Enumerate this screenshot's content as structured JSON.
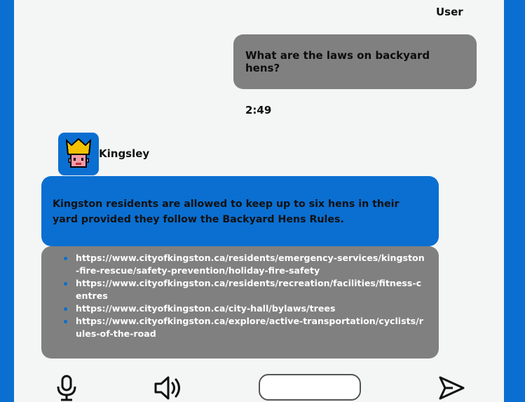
{
  "chat": {
    "user_label": "User",
    "user_message": "What are the laws on backyard hens?",
    "timestamp": "2:49",
    "bot_name": "Kingsley",
    "bot_message": "Kingston residents are allowed to keep up to six hens in their yard provided they follow the Backyard Hens Rules.",
    "sources": [
      "https://www.cityofkingston.ca/residents/emergency-services/kingston-fire-rescue/safety-prevention/holiday-fire-safety",
      "https://www.cityofkingston.ca/residents/recreation/facilities/fitness-centres",
      "https://www.cityofkingston.ca/city-hall/bylaws/trees",
      "https://www.cityofkingston.ca/explore/active-transportation/cyclists/rules-of-the-road"
    ]
  },
  "input": {
    "value": "",
    "placeholder": ""
  },
  "icons": {
    "mic": "microphone-icon",
    "speaker": "speaker-icon",
    "send": "send-icon",
    "avatar": "crowned-avatar"
  },
  "colors": {
    "brand_blue": "#0a6fd1",
    "bubble_gray": "#808080",
    "panel_bg": "#f4f5f5",
    "avatar_crown": "#f2c200",
    "avatar_face": "#f29aa8"
  }
}
